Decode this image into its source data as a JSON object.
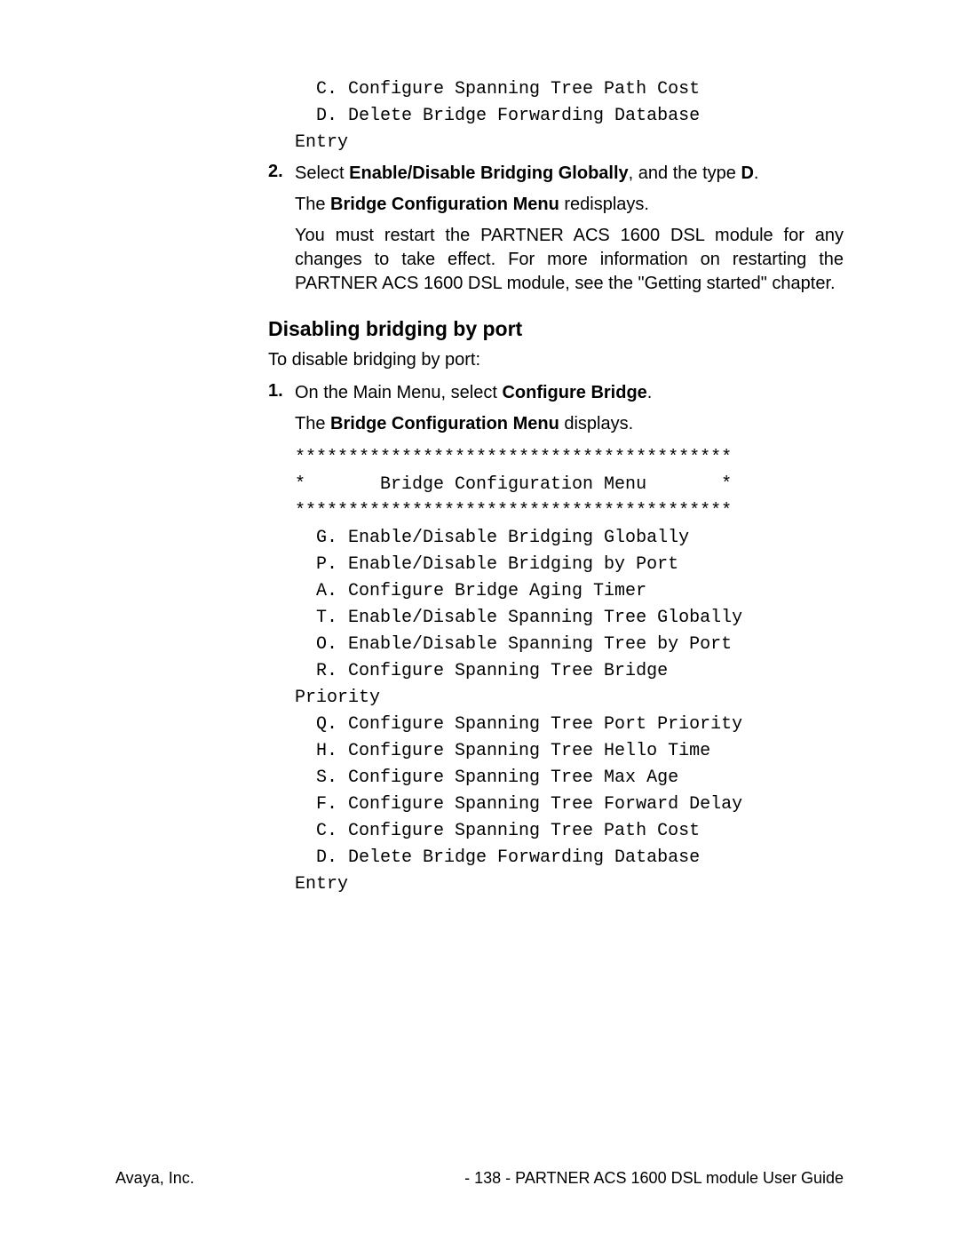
{
  "top_menu_tail": {
    "item_c": "  C. Configure Spanning Tree Path Cost",
    "blank1": "",
    "item_d": "  D. Delete Bridge Forwarding Database",
    "item_d2": "Entry"
  },
  "step2": {
    "number": "2.",
    "text_pre": "Select ",
    "text_bold1": "Enable/Disable Bridging Globally",
    "text_mid": ", and the type ",
    "text_bold2": "D",
    "text_end": "."
  },
  "redisplay": {
    "pre": "The ",
    "bold": "Bridge Configuration Menu",
    "post": " redisplays."
  },
  "restart_paragraph": "You must restart the PARTNER ACS 1600 DSL module for any changes to take effect.  For more information on restarting the PARTNER ACS 1600 DSL module, see the \"Getting started\" chapter.",
  "section_heading": "Disabling bridging by port",
  "intro_line": "To disable bridging by port:",
  "step1": {
    "number": "1.",
    "pre": "On the Main Menu, select ",
    "bold": "Configure Bridge",
    "post": "."
  },
  "displays_line": {
    "pre": "The ",
    "bold": "Bridge Configuration Menu",
    "post": " displays."
  },
  "menu": {
    "border_top": "*****************************************",
    "title": "*       Bridge Configuration Menu       *",
    "border_bot": "*****************************************",
    "g": "  G. Enable/Disable Bridging Globally",
    "p": "  P. Enable/Disable Bridging by Port",
    "a": "  A. Configure Bridge Aging Timer",
    "blankA": "",
    "t": "  T. Enable/Disable Spanning Tree Globally",
    "o": "  O. Enable/Disable Spanning Tree by Port",
    "r": "  R. Configure Spanning Tree Bridge",
    "r2": "Priority",
    "q": "  Q. Configure Spanning Tree Port Priority",
    "h": "  H. Configure Spanning Tree Hello Time",
    "s": "  S. Configure Spanning Tree Max Age",
    "f": "  F. Configure Spanning Tree Forward Delay",
    "c": "  C. Configure Spanning Tree Path Cost",
    "blankB": "",
    "d": "  D. Delete Bridge Forwarding Database",
    "d2": "Entry"
  },
  "footer": {
    "left": "Avaya, Inc.",
    "right": "- 138 - PARTNER ACS 1600 DSL module User Guide"
  }
}
